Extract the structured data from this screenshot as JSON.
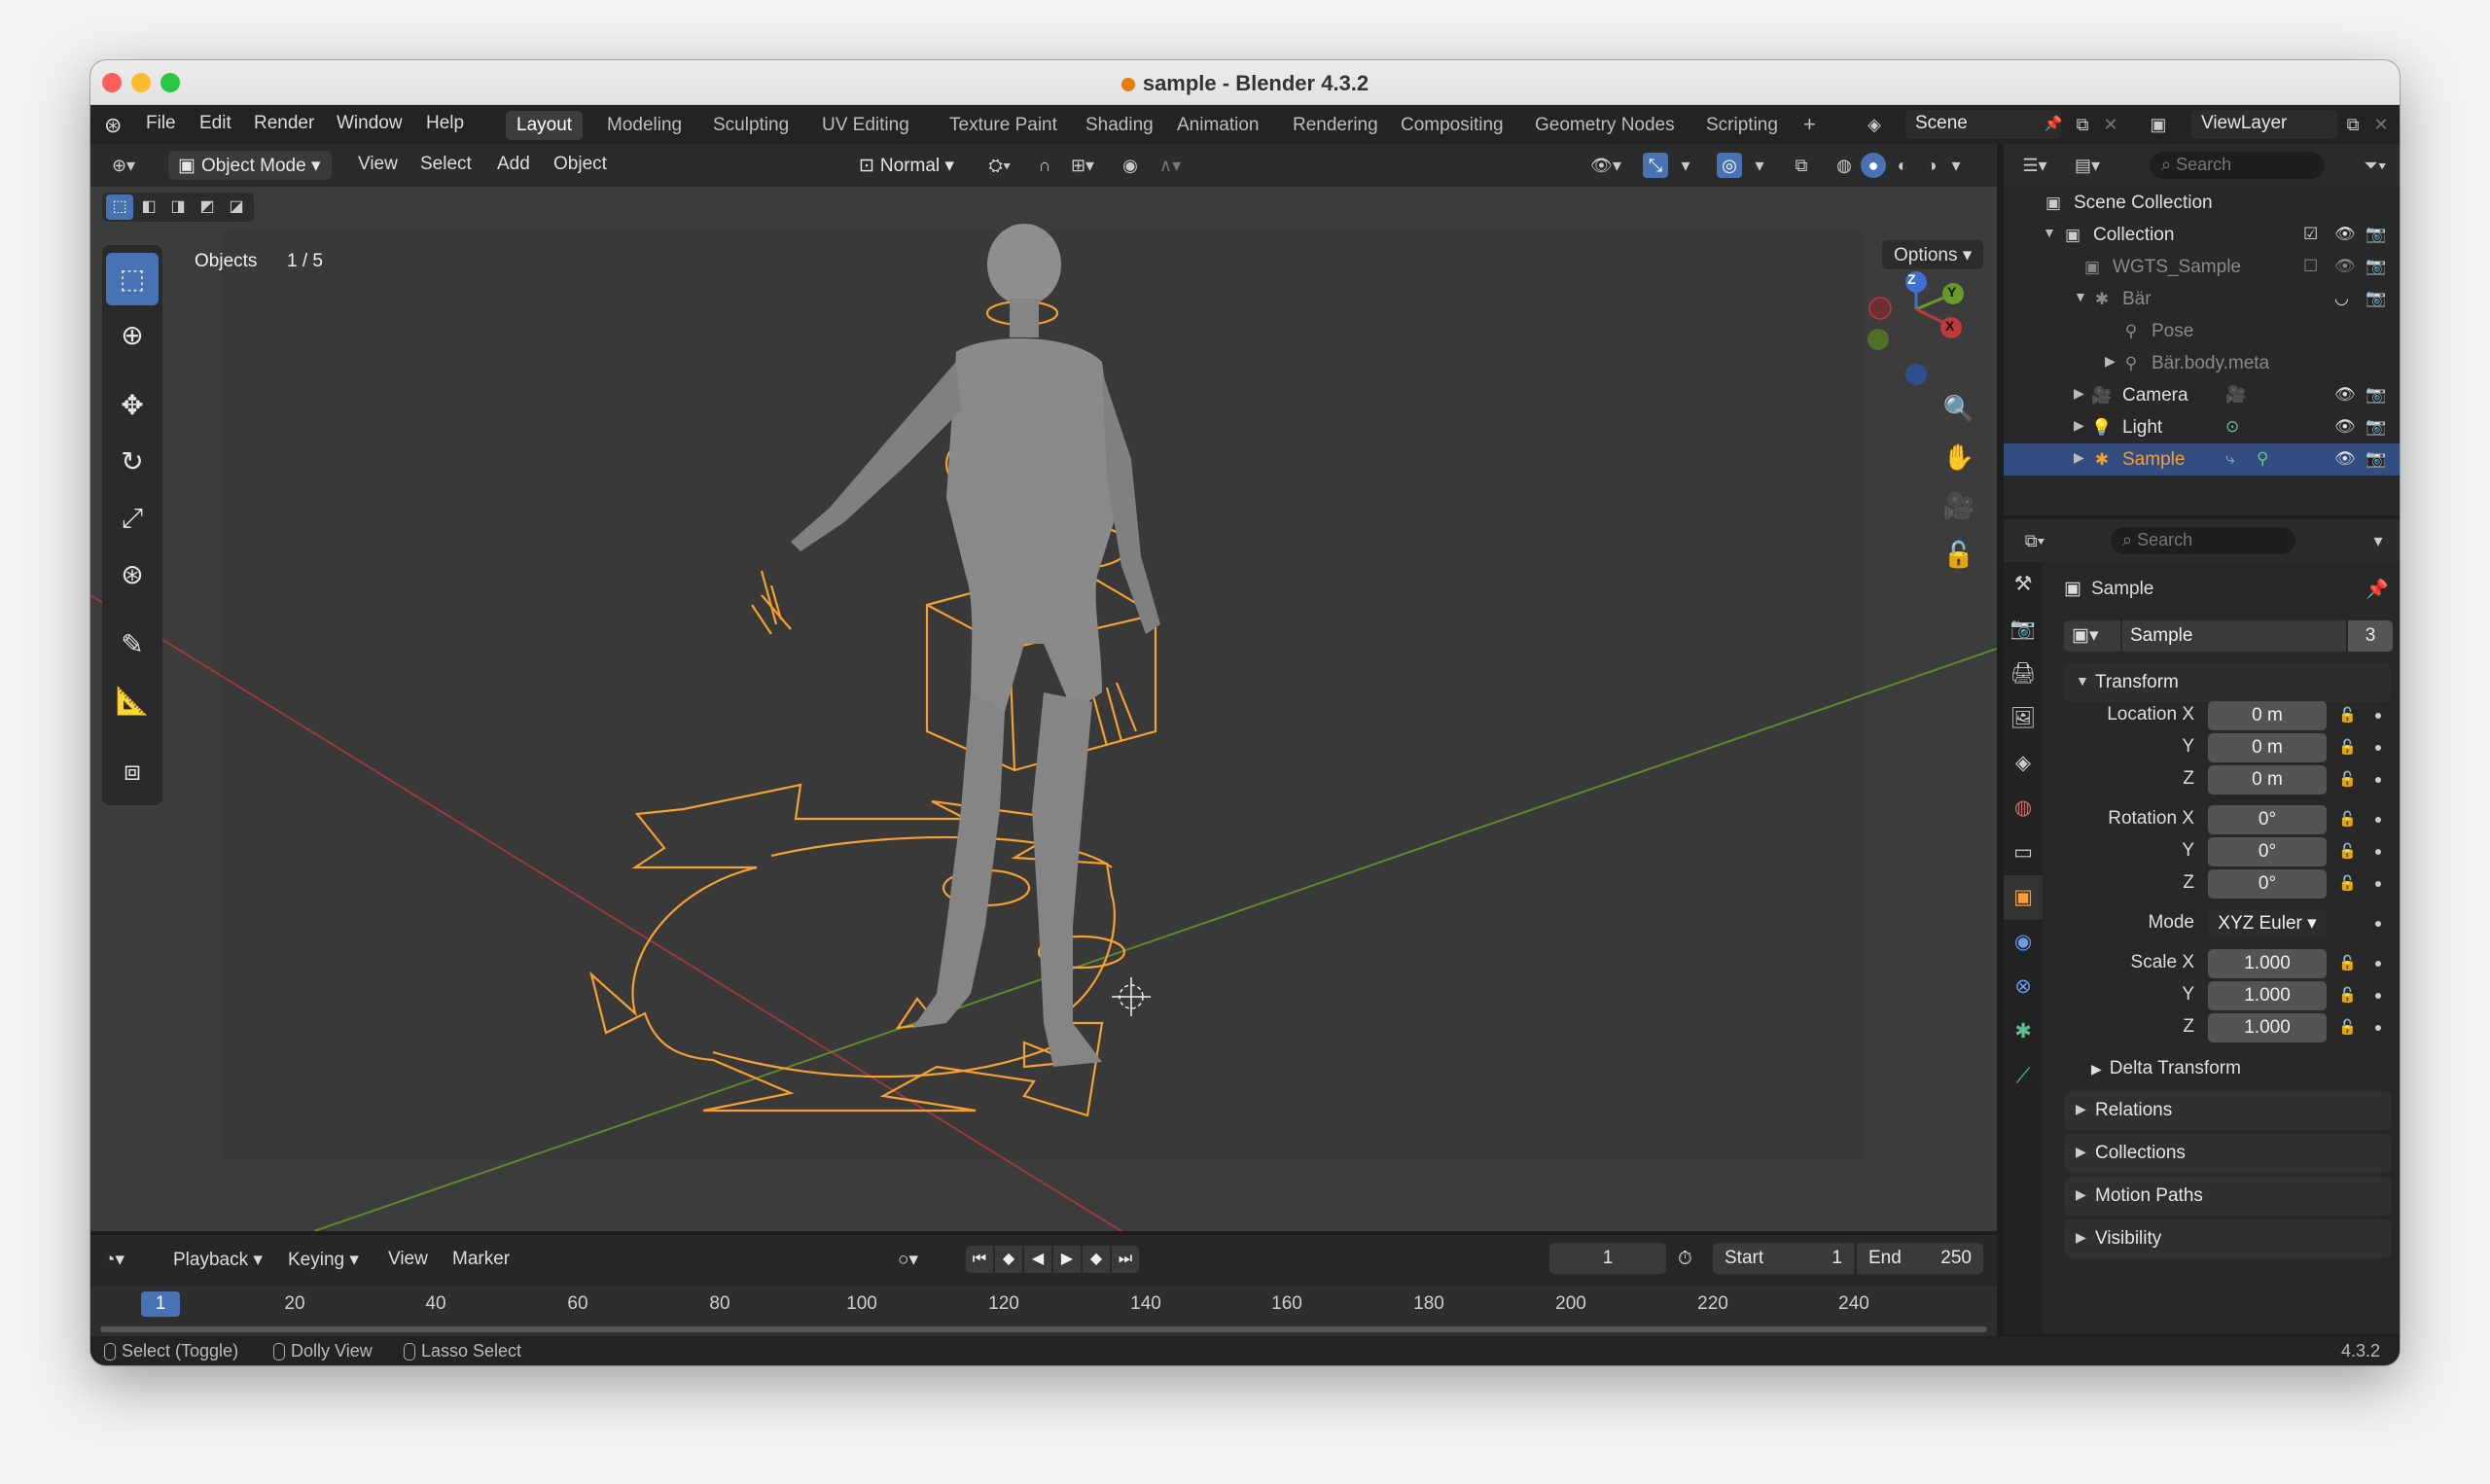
{
  "window_title": "sample - Blender 4.3.2",
  "menus": [
    "File",
    "Edit",
    "Render",
    "Window",
    "Help"
  ],
  "workspaces": [
    "Layout",
    "Modeling",
    "Sculpting",
    "UV Editing",
    "Texture Paint",
    "Shading",
    "Animation",
    "Rendering",
    "Compositing",
    "Geometry Nodes",
    "Scripting"
  ],
  "active_workspace": "Layout",
  "add_workspace": "+",
  "scene_name": "Scene",
  "view_layer": "ViewLayer",
  "viewport": {
    "mode": "Object Mode",
    "menus": [
      "View",
      "Select",
      "Add",
      "Object"
    ],
    "orientation": "Normal",
    "objects_label": "Objects",
    "objects_count": "1 / 5",
    "options": "Options",
    "gizmo_axes": [
      "Z",
      "Y",
      "X"
    ]
  },
  "timeline": {
    "menus": [
      "Playback",
      "Keying",
      "View",
      "Marker"
    ],
    "current_frame": "1",
    "start_label": "Start",
    "start_value": "1",
    "end_label": "End",
    "end_value": "250",
    "cursor_frame": "1",
    "ticks": [
      "20",
      "40",
      "60",
      "80",
      "100",
      "120",
      "140",
      "160",
      "180",
      "200",
      "220",
      "240"
    ]
  },
  "status": {
    "items": [
      "Select (Toggle)",
      "Dolly View",
      "Lasso Select"
    ],
    "version": "4.3.2"
  },
  "outliner": {
    "search_placeholder": "Search",
    "rows": [
      {
        "label": "Scene Collection"
      },
      {
        "label": "Collection"
      },
      {
        "label": "WGTS_Sample"
      },
      {
        "label": "Bär"
      },
      {
        "label": "Pose"
      },
      {
        "label": "Bär.body.meta"
      },
      {
        "label": "Camera"
      },
      {
        "label": "Light"
      },
      {
        "label": "Sample"
      }
    ]
  },
  "properties": {
    "search_placeholder": "Search",
    "object_name": "Sample",
    "data_name": "Sample",
    "data_users": "3",
    "transform_label": "Transform",
    "location": {
      "label": "Location X",
      "x": "0 m",
      "y": "0 m",
      "z": "0 m"
    },
    "rotation": {
      "label": "Rotation X",
      "x": "0°",
      "y": "0°",
      "z": "0°"
    },
    "mode_label": "Mode",
    "mode_value": "XYZ Euler",
    "scale": {
      "label": "Scale X",
      "x": "1.000",
      "y": "1.000",
      "z": "1.000"
    },
    "axis_y": "Y",
    "axis_z": "Z",
    "delta_transform": "Delta Transform",
    "panels": [
      "Relations",
      "Collections",
      "Motion Paths",
      "Visibility"
    ]
  },
  "colors": {
    "accent": "#4772b3",
    "selection_orange": "#f5a030",
    "x_axis": "#c0393b",
    "y_axis": "#6a9a2a",
    "z_axis": "#3f6fd0"
  }
}
